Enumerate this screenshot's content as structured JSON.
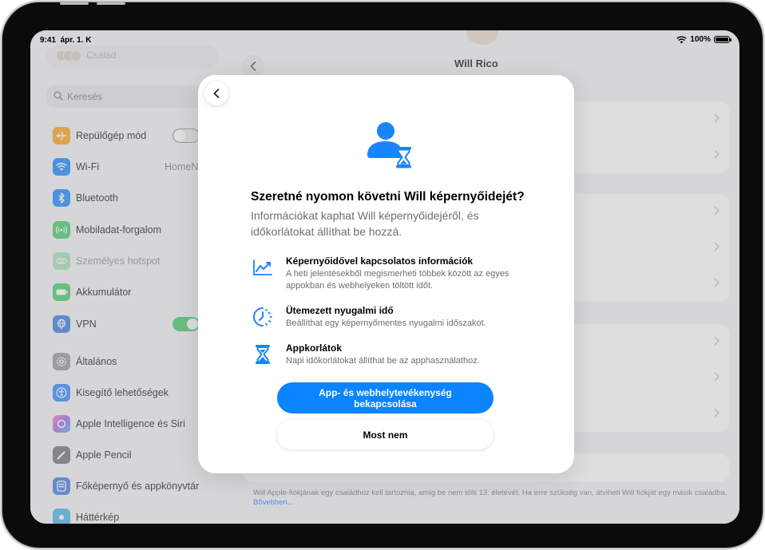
{
  "status_bar": {
    "time": "9:41",
    "date": "ápr. 1. K",
    "battery": "100%"
  },
  "sidebar": {
    "family_label": "Család",
    "search_placeholder": "Keresés",
    "items": [
      {
        "label": "Repülőgép mód",
        "icon": "airplane-icon",
        "color": "#ff9500"
      },
      {
        "label": "Wi-Fi",
        "icon": "wifi-icon",
        "color": "#007aff",
        "value": "HomeN"
      },
      {
        "label": "Bluetooth",
        "icon": "bluetooth-icon",
        "color": "#007aff"
      },
      {
        "label": "Mobiladat-forgalom",
        "icon": "antenna-icon",
        "color": "#34c759"
      },
      {
        "label": "Személyes hotspot",
        "icon": "hotspot-icon",
        "color": "#34c759"
      },
      {
        "label": "Akkumulátor",
        "icon": "battery-icon",
        "color": "#34c759"
      },
      {
        "label": "VPN",
        "icon": "vpn-globe-icon",
        "color": "#1f6fd9"
      },
      {
        "label": "Általános",
        "icon": "gear-icon",
        "color": "#8e8e93"
      },
      {
        "label": "Kisegítő lehetőségek",
        "icon": "accessibility-icon",
        "color": "#1e78ff"
      },
      {
        "label": "Apple Intelligence és Siri",
        "icon": "siri-icon",
        "color": "#9b59e0"
      },
      {
        "label": "Apple Pencil",
        "icon": "pencil-icon",
        "color": "#636366"
      },
      {
        "label": "Főképernyő és appkönyvtár",
        "icon": "home-screen-icon",
        "color": "#2f6fe0"
      },
      {
        "label": "Háttérkép",
        "icon": "wallpaper-icon",
        "color": "#32ade6"
      }
    ]
  },
  "detail": {
    "nav_title": "Will Rico",
    "footnote": "Will Apple-fiókjának egy családhoz kell tartoznia, amíg be nem tölti 13. életévét. Ha erre szükség van, átviheti Will fiókját egy másik családba.",
    "footnote_link": "Bővebben..."
  },
  "modal": {
    "title": "Szeretné nyomon követni Will képernyőidejét?",
    "subtitle": "Információkat kaphat Will képernyőidejéről, és időkorlátokat állíthat be hozzá.",
    "features": [
      {
        "icon": "chart-icon",
        "title": "Képernyőidővel kapcsolatos információk",
        "desc": "A heti jelentésekből megismerheti többek között az egyes appokban és webhelyeken töltött időt."
      },
      {
        "icon": "downtime-icon",
        "title": "Ütemezett nyugalmi idő",
        "desc": "Beállíthat egy képernyőmentes nyugalmi időszakot."
      },
      {
        "icon": "hourglass-icon",
        "title": "Appkorlátok",
        "desc": "Napi időkorlátokat állíthat be az apphasználathoz."
      }
    ],
    "primary_button": "App- és webhelytevékenység bekapcsolása",
    "secondary_button": "Most nem"
  }
}
